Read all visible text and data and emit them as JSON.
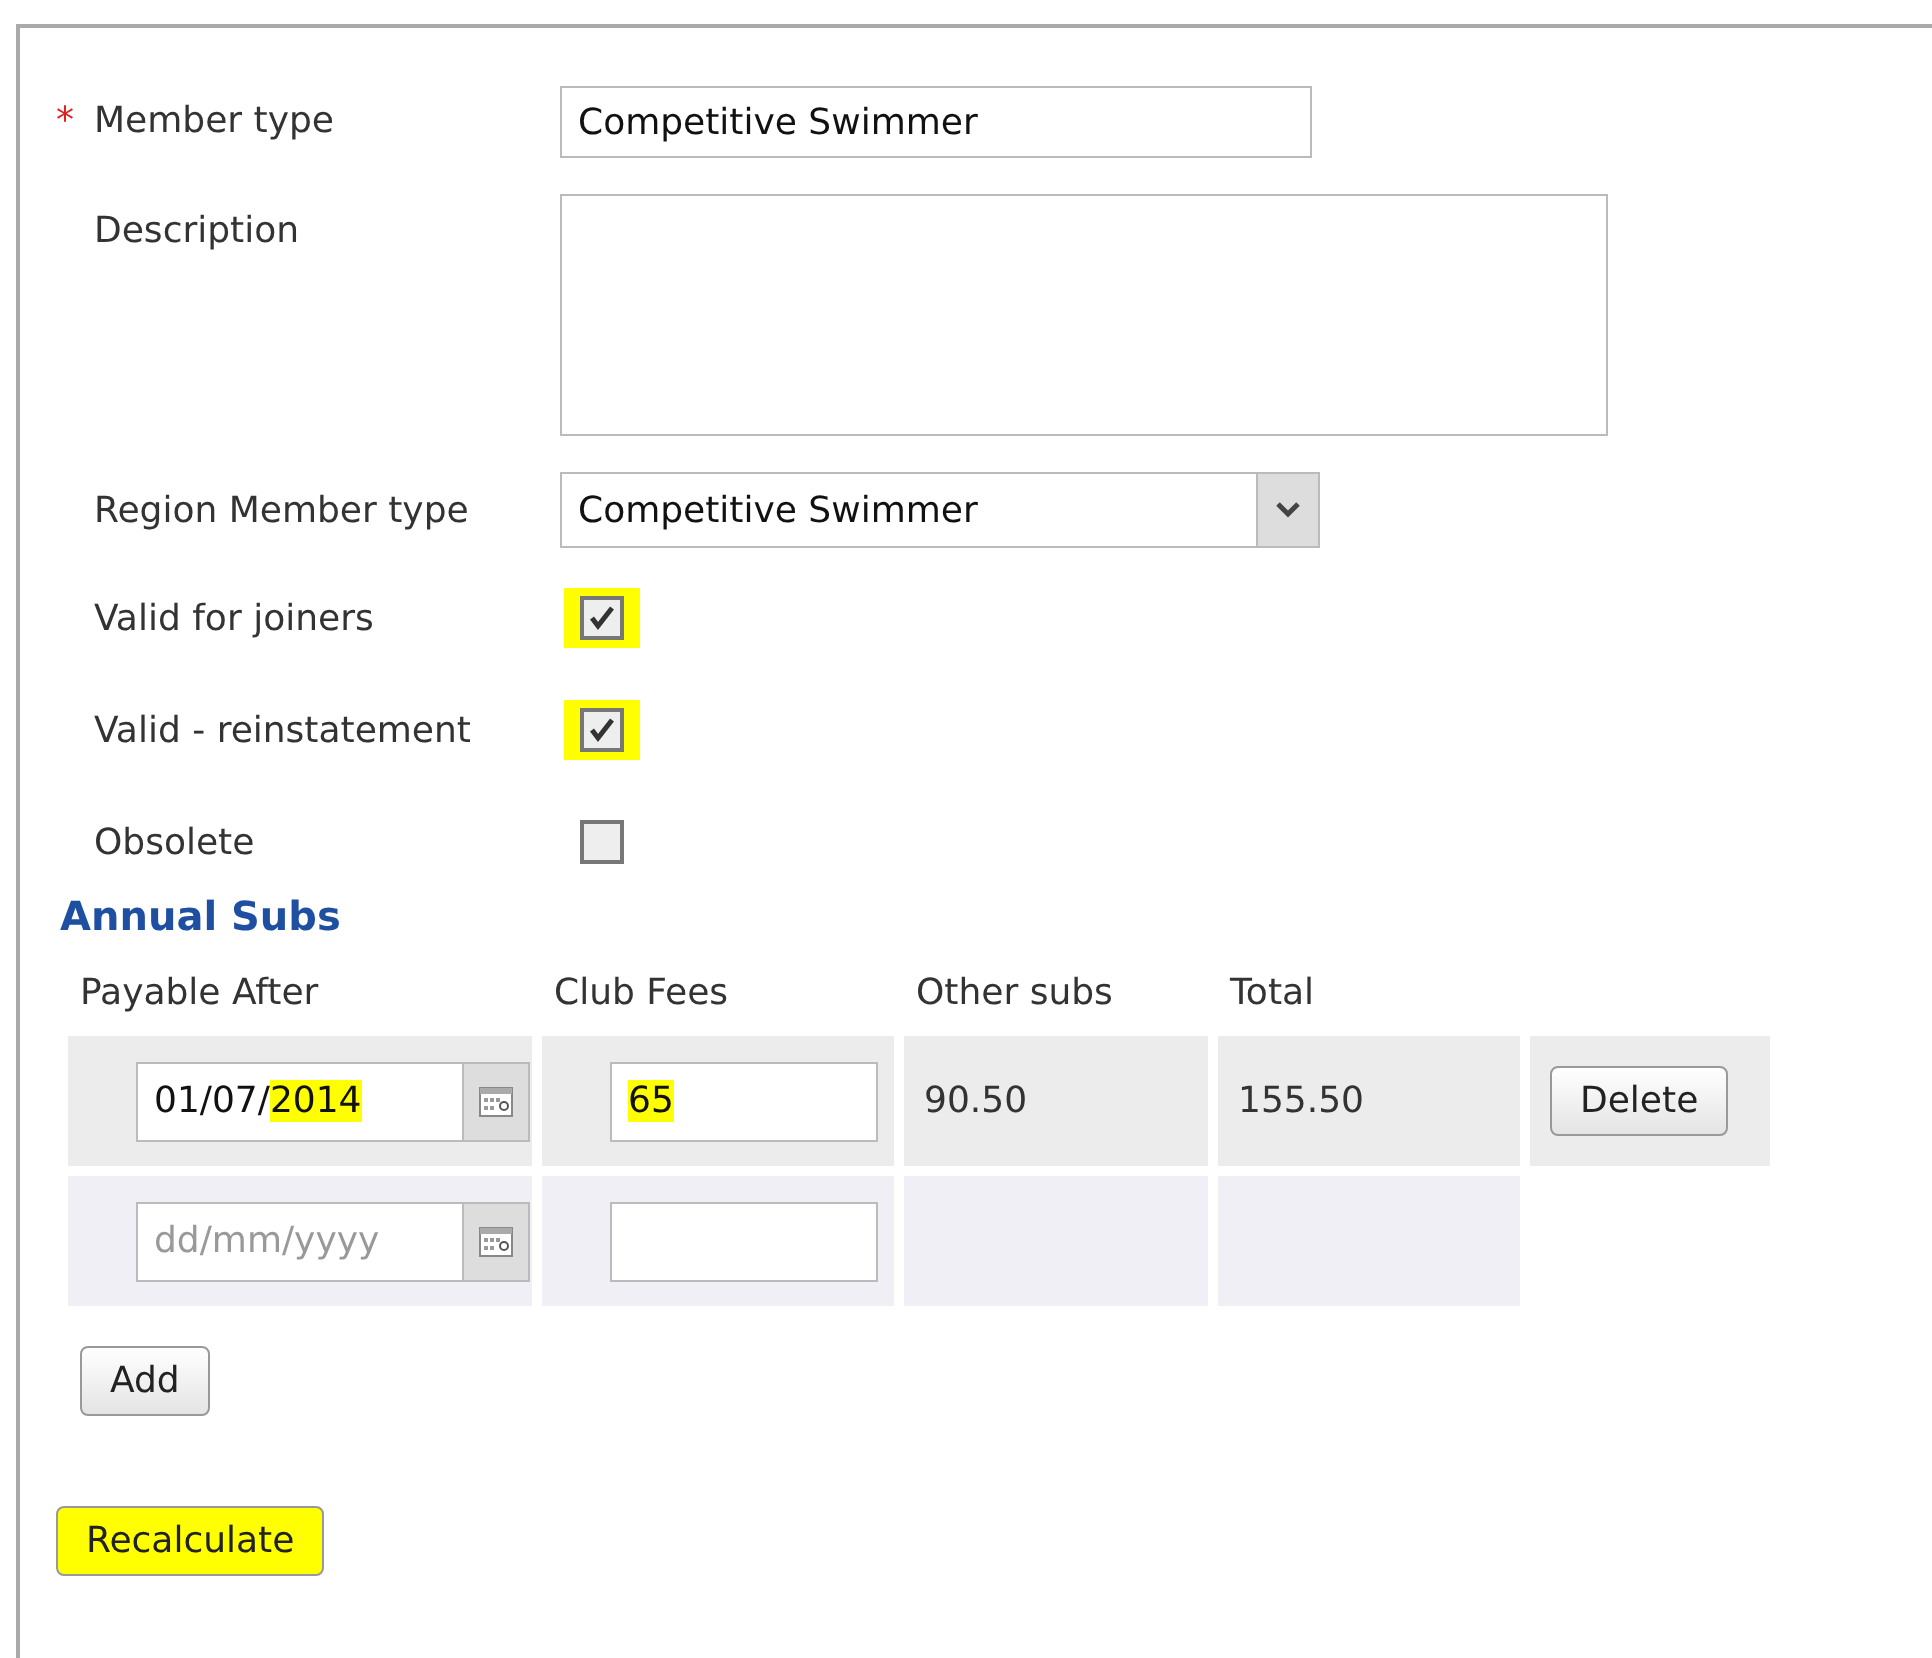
{
  "form": {
    "member_type": {
      "label": "Member type",
      "required_mark": "*",
      "value": "Competitive Swimmer"
    },
    "description": {
      "label": "Description"
    },
    "region_member_type": {
      "label": "Region Member type",
      "value": "Competitive Swimmer"
    },
    "checkboxes": [
      {
        "label": "Valid for joiners",
        "checked": true,
        "highlighted": true
      },
      {
        "label": "Valid - reinstatement",
        "checked": true,
        "highlighted": true
      },
      {
        "label": "Obsolete",
        "checked": false,
        "highlighted": false
      }
    ]
  },
  "annual_subs": {
    "title": "Annual Subs",
    "columns": [
      "Payable After",
      "Club Fees",
      "Other subs",
      "Total"
    ],
    "rows": [
      {
        "payable_after": "01/07/2014",
        "payable_after_highlighted": true,
        "club_fees": "65",
        "club_fees_highlighted": true,
        "other_subs": "90.50",
        "total": "155.50",
        "action": "Delete"
      },
      {
        "payable_after_placeholder": "dd/mm/yyyy"
      }
    ],
    "add_button": "Add"
  },
  "recalculate_button": {
    "label": "Recalculate",
    "highlighted": true
  }
}
